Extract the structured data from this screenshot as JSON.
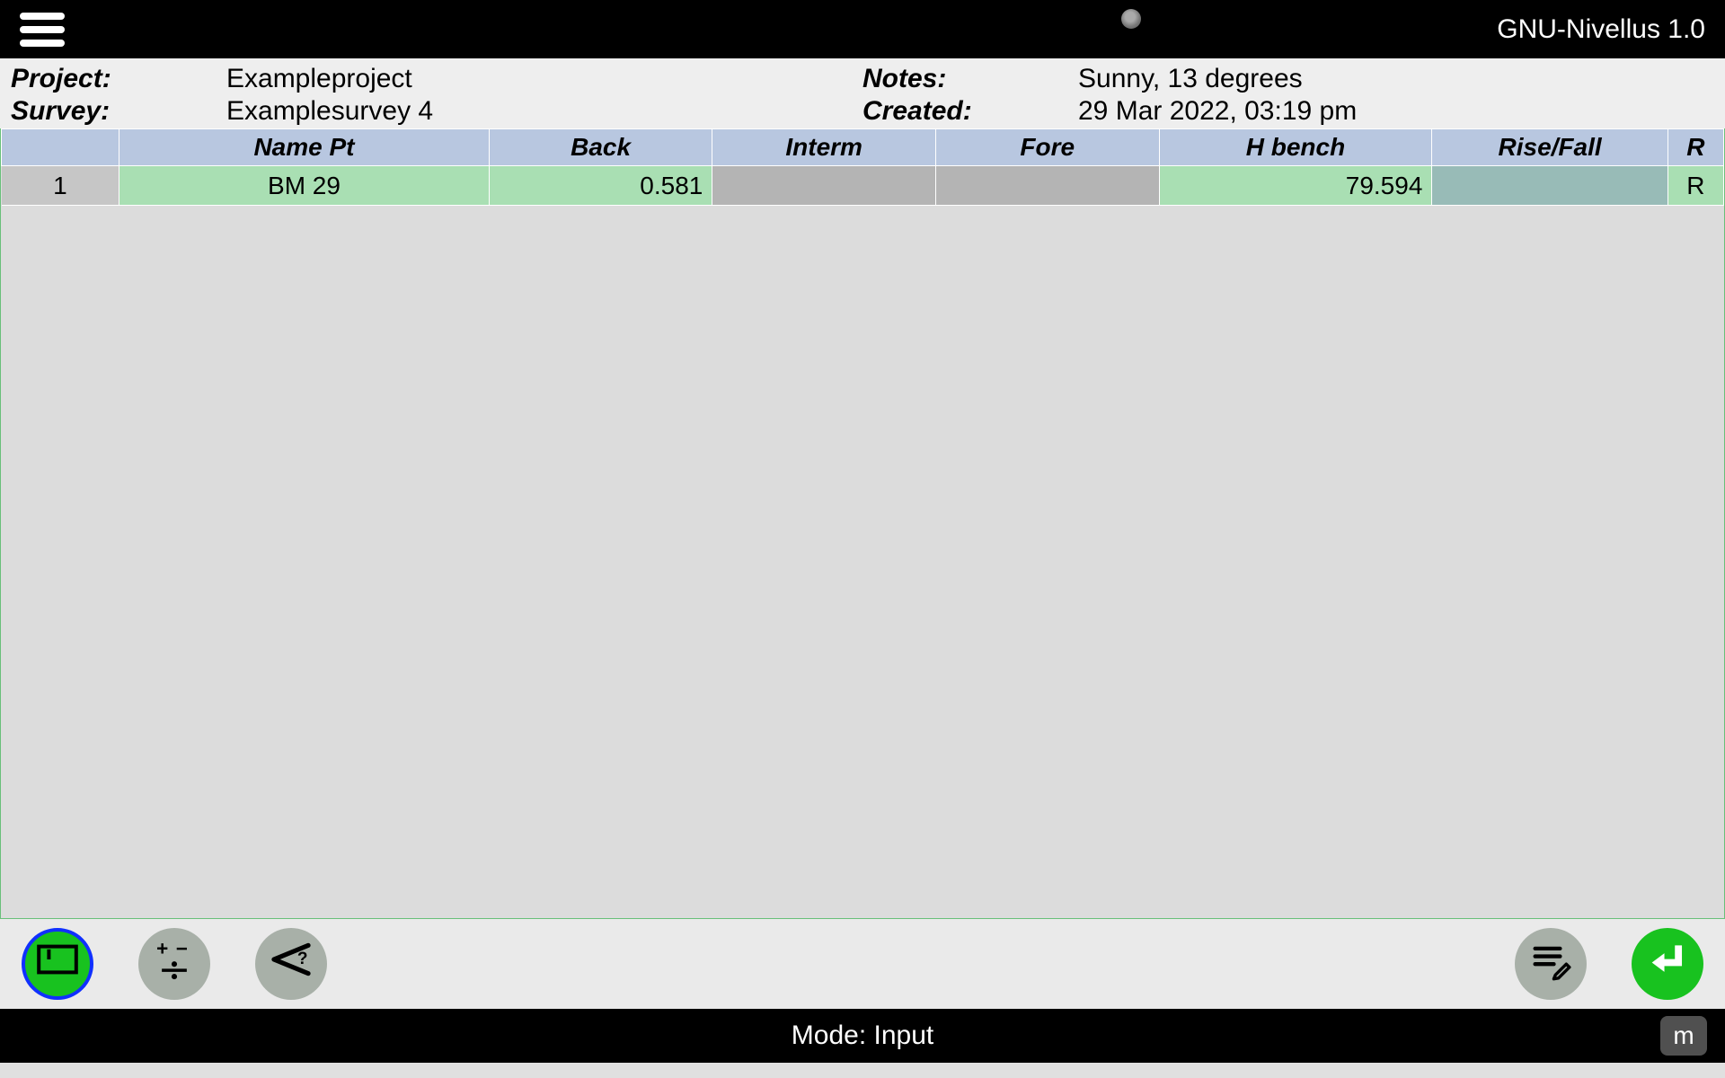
{
  "app": {
    "title": "GNU-Nivellus 1.0"
  },
  "meta": {
    "project_label": "Project:",
    "project_value": "Exampleproject",
    "survey_label": "Survey:",
    "survey_value": "Examplesurvey 4",
    "notes_label": "Notes:",
    "notes_value": "Sunny, 13 degrees",
    "created_label": "Created:",
    "created_value": "29 Mar 2022, 03:19 pm"
  },
  "table": {
    "headers": {
      "idx": "",
      "name": "Name Pt",
      "back": "Back",
      "interm": "Interm",
      "fore": "Fore",
      "hbench": "H bench",
      "risefall": "Rise/Fall",
      "r": "R"
    },
    "rows": [
      {
        "idx": "1",
        "name": "BM 29",
        "back": "0.581",
        "interm": "",
        "fore": "",
        "hbench": "79.594",
        "risefall": "",
        "r": "R"
      }
    ]
  },
  "status": {
    "mode_label": "Mode: Input",
    "unit": "m"
  }
}
